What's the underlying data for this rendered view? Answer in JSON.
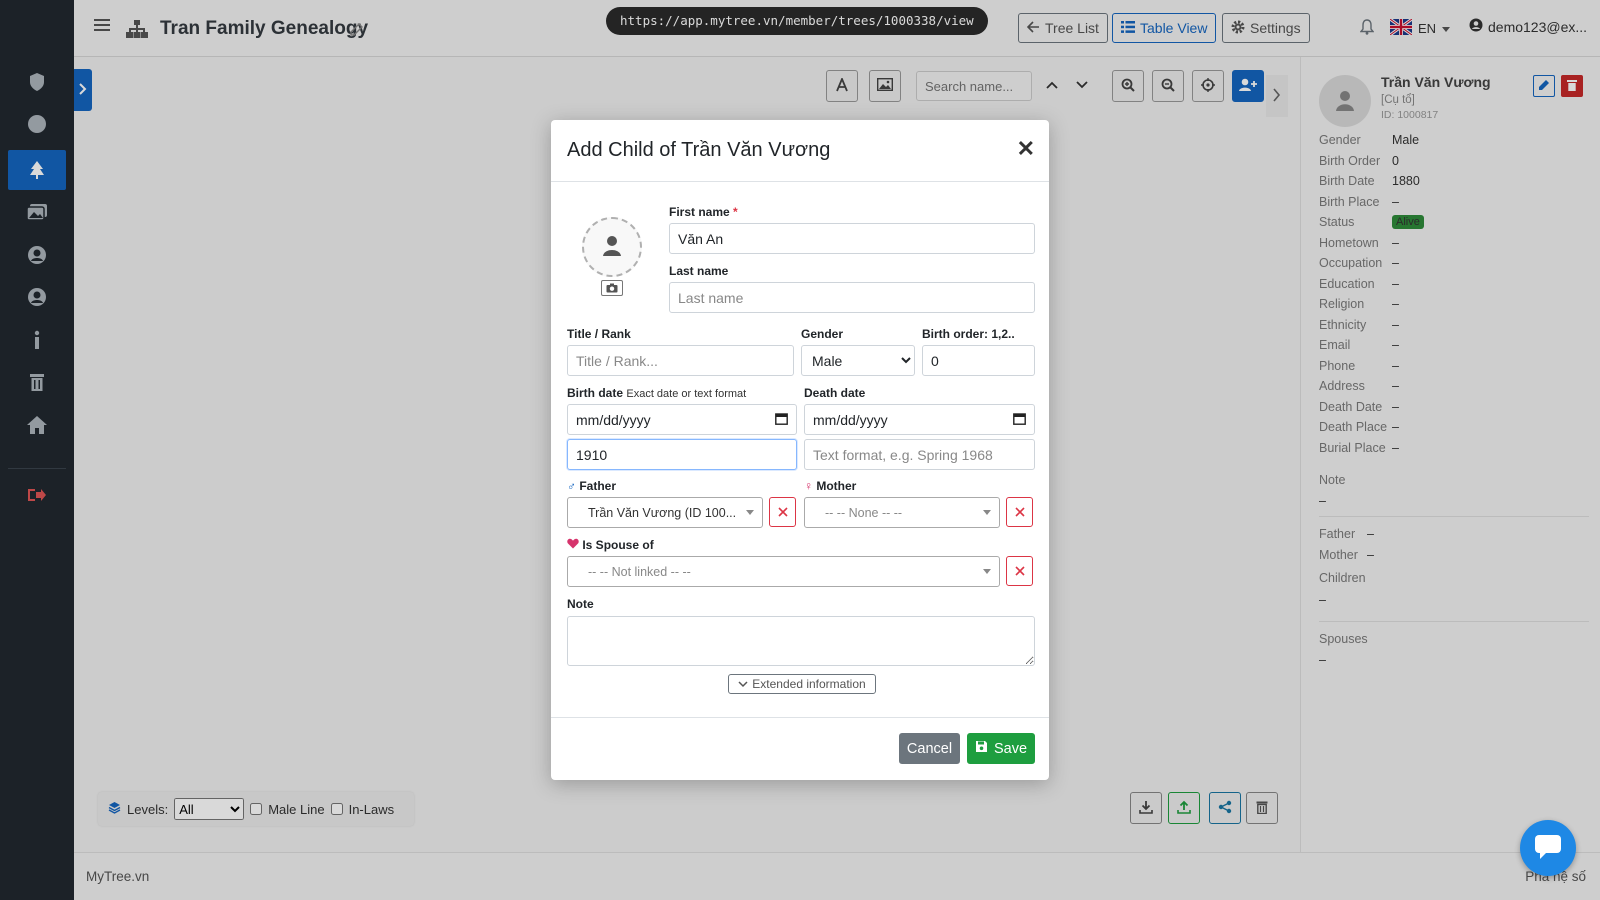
{
  "topbar": {
    "title": "Tran Family Genealogy",
    "url": "https://app.mytree.vn/member/trees/1000338/view",
    "tree_list_label": "Tree List",
    "table_view_label": "Table View",
    "settings_label": "Settings",
    "language": "EN",
    "user": "demo123@ex..."
  },
  "canvas": {
    "search_placeholder": "Search name...",
    "levels_label": "Levels:",
    "levels_value": "All",
    "male_line_label": "Male Line",
    "in_laws_label": "In-Laws"
  },
  "panel": {
    "name": "Trần Văn Vương",
    "title": "[Cụ tổ]",
    "id": "ID: 1000817",
    "fields": [
      {
        "key": "Gender",
        "value": "Male"
      },
      {
        "key": "Birth Order",
        "value": "0"
      },
      {
        "key": "Birth Date",
        "value": "1880"
      },
      {
        "key": "Birth Place",
        "value": "–"
      },
      {
        "key": "Status",
        "value": "Alive"
      },
      {
        "key": "Hometown",
        "value": "–"
      },
      {
        "key": "Occupation",
        "value": "–"
      },
      {
        "key": "Education",
        "value": "–"
      },
      {
        "key": "Religion",
        "value": "–"
      },
      {
        "key": "Ethnicity",
        "value": "–"
      },
      {
        "key": "Email",
        "value": "–"
      },
      {
        "key": "Phone",
        "value": "–"
      },
      {
        "key": "Address",
        "value": "–"
      },
      {
        "key": "Death Date",
        "value": "–"
      },
      {
        "key": "Death Place",
        "value": "–"
      },
      {
        "key": "Burial Place",
        "value": "–"
      }
    ],
    "note_label": "Note",
    "note_value": "–",
    "father_label": "Father",
    "father_value": "–",
    "mother_label": "Mother",
    "mother_value": "–",
    "children_label": "Children",
    "children_value": "–",
    "spouses_label": "Spouses",
    "spouses_value": "–"
  },
  "footer": {
    "brand": "MyTree.vn",
    "version": "Phả hệ số"
  },
  "modal": {
    "title": "Add Child of Trần Văn Vương",
    "first_name_label": "First name",
    "first_name_required": "*",
    "first_name_value": "Văn An",
    "last_name_label": "Last name",
    "last_name_placeholder": "Last name",
    "title_rank_label": "Title / Rank",
    "title_rank_placeholder": "Title / Rank...",
    "gender_label": "Gender",
    "gender_value": "Male",
    "birth_order_label": "Birth order: 1,2..",
    "birth_order_value": "0",
    "birth_date_label": "Birth date",
    "birth_date_hint": "Exact date or text format",
    "birth_date_placeholder": "mm/dd/yyyy",
    "birth_date_text_value": "1910",
    "death_date_label": "Death date",
    "death_date_placeholder": "mm/dd/yyyy",
    "death_date_text_placeholder": "Text format, e.g. Spring 1968",
    "father_label": "Father",
    "father_value": "Trần Văn Vương (ID 100...",
    "mother_label": "Mother",
    "mother_value": "-- -- None -- --",
    "spouse_label": "Is Spouse of",
    "spouse_value": "-- -- Not linked -- --",
    "note_label": "Note",
    "extended_label": "Extended information",
    "cancel_label": "Cancel",
    "save_label": "Save"
  },
  "colors": {
    "primary": "#1565c0",
    "success": "#1e9e3f",
    "danger": "#dc3545",
    "sidebar": "#212830"
  }
}
